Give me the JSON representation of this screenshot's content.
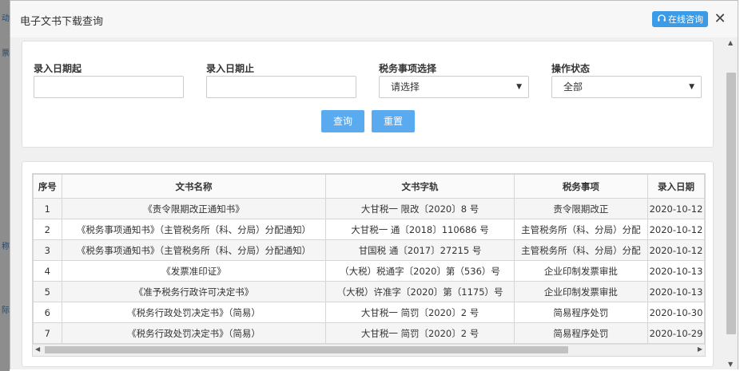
{
  "dialog": {
    "title": "电子文书下载查询",
    "online_button": "在线咨询",
    "close_symbol": "✕"
  },
  "filters": {
    "date_from_label": "录入日期起",
    "date_to_label": "录入日期止",
    "tax_item_label": "税务事项选择",
    "tax_item_value": "请选择",
    "status_label": "操作状态",
    "status_value": "全部",
    "query_button": "查询",
    "reset_button": "重置"
  },
  "table": {
    "headers": [
      "序号",
      "文书名称",
      "文书字轨",
      "税务事项",
      "录入日期"
    ],
    "rows": [
      [
        "1",
        "《责令限期改正通知书》",
        "大甘税一 限改〔2020〕8 号",
        "责令限期改正",
        "2020-10-12"
      ],
      [
        "2",
        "《税务事项通知书》（主管税务所（科、分局）分配通知）",
        "大甘税一 通〔2018〕110686 号",
        "主管税务所（科、分局）分配",
        "2020-10-12"
      ],
      [
        "3",
        "《税务事项通知书》（主管税务所（科、分局）分配通知）",
        "甘国税 通〔2017〕27215 号",
        "主管税务所（科、分局）分配",
        "2020-10-12"
      ],
      [
        "4",
        "《发票准印证》",
        "（大税）税通字〔2020〕第（536）号",
        "企业印制发票审批",
        "2020-10-13"
      ],
      [
        "5",
        "《准予税务行政许可决定书》",
        "（大税）许准字〔2020〕第（1175）号",
        "企业印制发票审批",
        "2020-10-13"
      ],
      [
        "6",
        "《税务行政处罚决定书》（简易）",
        "大甘税一 简罚〔2020〕2 号",
        "简易程序处罚",
        "2020-10-30"
      ],
      [
        "7",
        "《税务行政处罚决定书》（简易）",
        "大甘税一 简罚〔2020〕2 号",
        "简易程序处罚",
        "2020-10-29"
      ]
    ]
  },
  "colors": {
    "accent": "#5aaaf0",
    "online_button": "#3c9be6"
  },
  "icons": {
    "online": "headset-icon",
    "close": "close-icon",
    "dropdown": "caret-down-icon"
  },
  "backdrop": {
    "fragments": [
      "动",
      "票",
      "称",
      "际"
    ]
  }
}
